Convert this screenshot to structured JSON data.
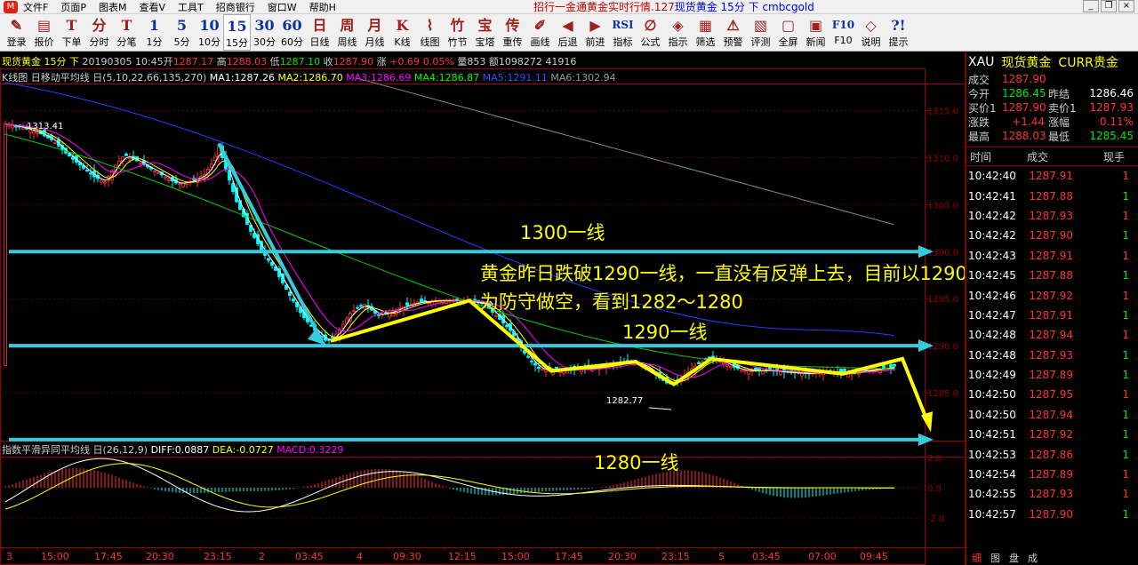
{
  "menubar": {
    "items": [
      "文件F",
      "页面P",
      "图表M",
      "查看V",
      "工具T",
      "招商银行",
      "窗口W",
      "帮助H"
    ],
    "ticker_red": "招行一金通黄金实时行情.127",
    "ticker_blue": "现货黄金 15分 下 cmbcgold"
  },
  "toolbar": [
    {
      "icon": "✎",
      "label": "登录"
    },
    {
      "icon": "▤",
      "label": "报价"
    },
    {
      "icon": "T",
      "label": "下单"
    },
    {
      "icon": "分",
      "label": "分时"
    },
    {
      "icon": "T",
      "label": "分笔"
    },
    {
      "icon": "1",
      "label": "1分"
    },
    {
      "icon": "5",
      "label": "5分"
    },
    {
      "icon": "10",
      "label": "10分"
    },
    {
      "icon": "15",
      "label": "15分",
      "active": true
    },
    {
      "icon": "30",
      "label": "30分"
    },
    {
      "icon": "60",
      "label": "60分"
    },
    {
      "icon": "日",
      "label": "日线"
    },
    {
      "icon": "周",
      "label": "周线"
    },
    {
      "icon": "月",
      "label": "月线"
    },
    {
      "icon": "K",
      "label": "K线"
    },
    {
      "icon": "⌇",
      "label": "线图"
    },
    {
      "icon": "竹",
      "label": "竹节"
    },
    {
      "icon": "宝",
      "label": "宝塔"
    },
    {
      "icon": "传",
      "label": "重传"
    },
    {
      "icon": "✐",
      "label": "画线"
    },
    {
      "icon": "◀",
      "label": "后退"
    },
    {
      "icon": "▶",
      "label": "前进"
    },
    {
      "icon": "RSI",
      "label": "指标"
    },
    {
      "icon": "∅",
      "label": "公式"
    },
    {
      "icon": "◈",
      "label": "指示"
    },
    {
      "icon": "▦",
      "label": "筛选"
    },
    {
      "icon": "⚠",
      "label": "预警"
    },
    {
      "icon": "▧",
      "label": "评测"
    },
    {
      "icon": "▢",
      "label": "全屏"
    },
    {
      "icon": "▣",
      "label": "新闻"
    },
    {
      "icon": "F10",
      "label": "F10"
    },
    {
      "icon": "◇",
      "label": "说明"
    },
    {
      "icon": "?!",
      "label": "提示"
    }
  ],
  "info": {
    "line1": [
      "现货黄金 15分 下",
      " 20190305 10:45开",
      "1287.17",
      " 高",
      "1288.03",
      " 低",
      "1287.10",
      " 收",
      "1287.90",
      " 涨 ",
      "+0.69",
      "0.05%",
      " 量853 额1098272 41916"
    ],
    "ma_title": "K线图 日移动平均线 日(5,10,22,66,135,270)",
    "ma1": "MA1:1287.26",
    "ma2": "MA2:1286.70",
    "ma3": "MA3:1286.69",
    "ma4": "MA4:1286.87",
    "ma5": "MA5:1291.11",
    "ma6": "MA6:1302.94",
    "macd_title": "指数平滑异同平均线 日(26,12,9)",
    "diff": "DIFF:0.0887",
    "dea": "DEA:-0.0727",
    "macd": "MACD:0.3229"
  },
  "chart_data": {
    "type": "candlestick",
    "y_axis_ticks": [
      "1315.0",
      "1310.0",
      "1305.0",
      "1300.0",
      "1295.0",
      "1290.0",
      "1285.0"
    ],
    "macd_ticks": [
      "2.0",
      "0.0",
      "-2.0"
    ],
    "x_ticks": [
      "3",
      "15:00",
      "17:45",
      "20:30",
      "23:15",
      "2",
      "03:45",
      "4",
      "09:30",
      "12:15",
      "15:00",
      "17:45",
      "20:30",
      "23:15",
      "5",
      "03:45",
      "07:00",
      "09:45"
    ],
    "annotations": {
      "start_price": "1313.41",
      "low_price": "1282.77",
      "line_1300": "1300一线",
      "line_1290": "1290一线",
      "line_1280": "1280一线",
      "comment_1": "黄金昨日跌破1290一线，一直没有反弹上去，目前以1290",
      "comment_2": "为防守做空，看到1282～1280"
    }
  },
  "quote": {
    "symbol": "XAU",
    "name": "现货黄金",
    "currency": "CURR贵金",
    "last_label": "成交",
    "last": "1287.90",
    "open_label": "今开",
    "open": "1286.45",
    "prev_label": "昨结",
    "prev": "1286.46",
    "bid_label": "买价1",
    "bid": "1287.90",
    "ask_label": "卖价1",
    "ask": "1287.93",
    "chg_label": "涨跌",
    "chg": "+1.44",
    "pct_label": "涨幅",
    "pct": "0.11%",
    "high_label": "最高",
    "high": "1288.03",
    "low_label": "最低",
    "low": "1285.45"
  },
  "ticks_header": [
    "时间",
    "成交",
    "现手"
  ],
  "ticks": [
    [
      "10:42:40",
      "1287.91",
      "1",
      "red"
    ],
    [
      "10:42:41",
      "1287.88",
      "1",
      "grn"
    ],
    [
      "10:42:42",
      "1287.93",
      "1",
      "red"
    ],
    [
      "10:42:42",
      "1287.90",
      "1",
      "grn"
    ],
    [
      "10:42:43",
      "1287.91",
      "1",
      "red"
    ],
    [
      "10:42:45",
      "1287.88",
      "1",
      "grn"
    ],
    [
      "10:42:46",
      "1287.92",
      "1",
      "red"
    ],
    [
      "10:42:47",
      "1287.91",
      "1",
      "grn"
    ],
    [
      "10:42:48",
      "1287.94",
      "1",
      "red"
    ],
    [
      "10:42:48",
      "1287.93",
      "1",
      "grn"
    ],
    [
      "10:42:49",
      "1287.89",
      "1",
      "grn"
    ],
    [
      "10:42:50",
      "1287.95",
      "1",
      "red"
    ],
    [
      "10:42:50",
      "1287.94",
      "1",
      "grn"
    ],
    [
      "10:42:51",
      "1287.92",
      "1",
      "grn"
    ],
    [
      "10:42:53",
      "1287.86",
      "1",
      "grn"
    ],
    [
      "10:42:54",
      "1287.89",
      "1",
      "red"
    ],
    [
      "10:42:55",
      "1287.93",
      "1",
      "red"
    ],
    [
      "10:42:57",
      "1287.90",
      "1",
      "grn"
    ]
  ],
  "bottom_tabs": [
    "细",
    "图",
    "盘",
    "成"
  ],
  "colors": {
    "up": "#ff3232",
    "down": "#00e600",
    "cyan_line": "#33ccdd",
    "arrow": "#ffff00"
  }
}
